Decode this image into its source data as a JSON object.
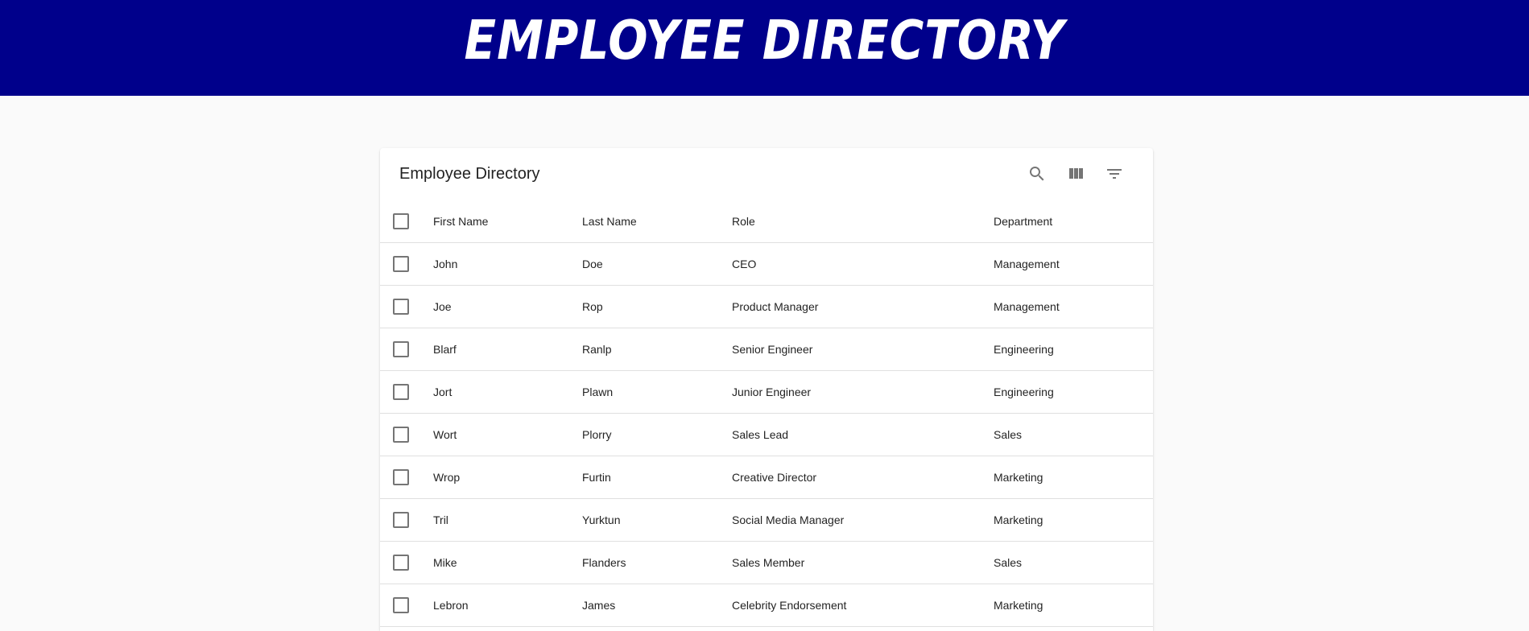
{
  "page": {
    "banner_title": "EMPLOYEE DIRECTORY"
  },
  "colors": {
    "banner_bg": "#00008b",
    "page_bg": "#fafafa"
  },
  "table": {
    "title": "Employee Directory",
    "toolbar_icons": [
      "search-icon",
      "view-column-icon",
      "filter-list-icon"
    ],
    "columns": [
      "First Name",
      "Last Name",
      "Role",
      "Department"
    ],
    "rows": [
      [
        "John",
        "Doe",
        "CEO",
        "Management"
      ],
      [
        "Joe",
        "Rop",
        "Product Manager",
        "Management"
      ],
      [
        "Blarf",
        "Ranlp",
        "Senior Engineer",
        "Engineering"
      ],
      [
        "Jort",
        "Plawn",
        "Junior Engineer",
        "Engineering"
      ],
      [
        "Wort",
        "Plorry",
        "Sales Lead",
        "Sales"
      ],
      [
        "Wrop",
        "Furtin",
        "Creative Director",
        "Marketing"
      ],
      [
        "Tril",
        "Yurktun",
        "Social Media Manager",
        "Marketing"
      ],
      [
        "Mike",
        "Flanders",
        "Sales Member",
        "Sales"
      ],
      [
        "Lebron",
        "James",
        "Celebrity Endorsement",
        "Marketing"
      ]
    ]
  }
}
